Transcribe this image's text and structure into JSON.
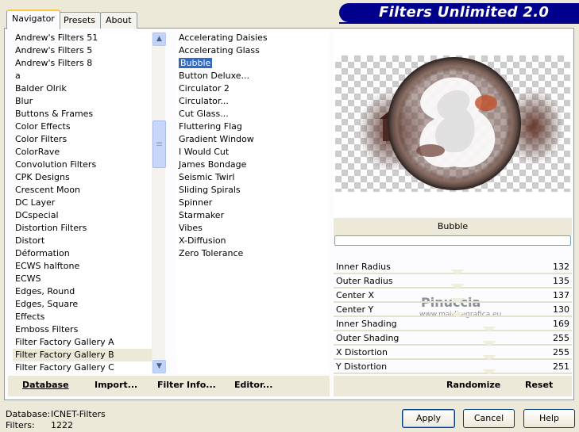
{
  "banner": {
    "title": "Filters Unlimited 2.0"
  },
  "tabs": [
    {
      "label": "Navigator",
      "active": true
    },
    {
      "label": "Presets",
      "active": false
    },
    {
      "label": "About",
      "active": false
    }
  ],
  "categories": {
    "items": [
      "Andrew's Filters 51",
      "Andrew's Filters 5",
      "Andrew's Filters 8",
      "a",
      "Balder Olrik",
      "Blur",
      "Buttons & Frames",
      "Color Effects",
      "Color Filters",
      "ColorRave",
      "Convolution Filters",
      "CPK Designs",
      "Crescent Moon",
      "DC Layer",
      "DCspecial",
      "Distortion Filters",
      "Distort",
      "Déformation",
      "ECWS halftone",
      "ECWS",
      "Edges, Round",
      "Edges, Square",
      "Effects",
      "Emboss Filters",
      "Filter Factory Gallery A",
      "Filter Factory Gallery B",
      "Filter Factory Gallery C"
    ],
    "selected": "Filter Factory Gallery B"
  },
  "filters": {
    "items": [
      "Accelerating Daisies",
      "Accelerating Glass",
      "Bubble",
      "Button Deluxe...",
      "Circulator 2",
      "Circulator...",
      "Cut Glass...",
      "Fluttering Flag",
      "Gradient Window",
      "I Would Cut",
      "James Bondage",
      "Seismic Twirl",
      "Sliding Spirals",
      "Spinner",
      "Starmaker",
      "Vibes",
      "X-Diffusion",
      "Zero Tolerance"
    ],
    "selected": "Bubble"
  },
  "preview": {
    "filter_name": "Bubble",
    "watermark_line1": "Pinuccia",
    "watermark_line2": "www.maidiregrafica.eu"
  },
  "parameters": [
    {
      "name": "Inner Radius",
      "value": "132"
    },
    {
      "name": "Outer Radius",
      "value": "135"
    },
    {
      "name": "Center X",
      "value": "137"
    },
    {
      "name": "Center Y",
      "value": "130"
    },
    {
      "name": "Inner Shading",
      "value": "169"
    },
    {
      "name": "Outer Shading",
      "value": "255"
    },
    {
      "name": "X Distortion",
      "value": "255"
    },
    {
      "name": "Y Distortion",
      "value": "251"
    }
  ],
  "actions_left": {
    "database": "Database",
    "import": "Import...",
    "filter_info": "Filter Info...",
    "editor": "Editor..."
  },
  "actions_right": {
    "randomize": "Randomize",
    "reset": "Reset"
  },
  "status": {
    "database_label": "Database:",
    "database_value": "ICNET-Filters",
    "filters_label": "Filters:",
    "filters_value": "1222"
  },
  "buttons": {
    "apply": "Apply",
    "cancel": "Cancel",
    "help": "Help"
  },
  "colors": {
    "banner": "#00008c",
    "selection": "#316ac5",
    "window": "#ece9d8"
  }
}
